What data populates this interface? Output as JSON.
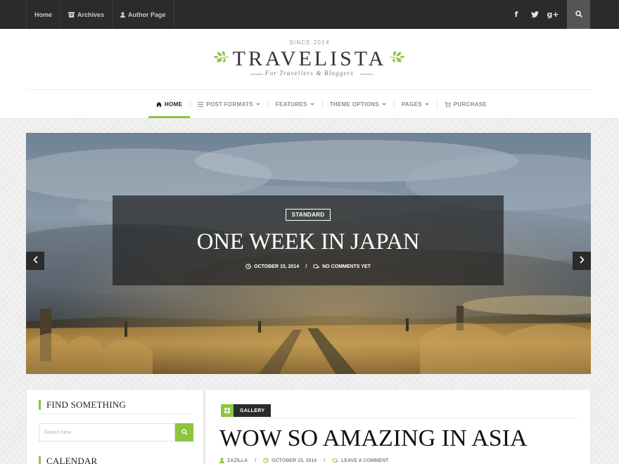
{
  "topbar": {
    "nav": [
      {
        "label": "Home",
        "icon": null
      },
      {
        "label": "Archives",
        "icon": "archive-icon"
      },
      {
        "label": "Author Page",
        "icon": "user-icon"
      }
    ],
    "social": {
      "facebook": "f",
      "twitter": "twitter-bird-icon",
      "googleplus": "g+"
    },
    "search_icon": "search-icon"
  },
  "header": {
    "since": "SINCE 2014",
    "logo": "TRAVELISTA",
    "tagline": "For Travellers & Bloggers",
    "accent": "#8cc63e"
  },
  "mainnav": {
    "items": [
      {
        "label": "HOME",
        "icon": "home-icon",
        "active": true,
        "dropdown": false
      },
      {
        "label": "POST FORMATS",
        "icon": "list-icon",
        "active": false,
        "dropdown": true
      },
      {
        "label": "FEATURES",
        "icon": null,
        "active": false,
        "dropdown": true
      },
      {
        "label": "THEME OPTIONS",
        "icon": null,
        "active": false,
        "dropdown": true
      },
      {
        "label": "PAGES",
        "icon": null,
        "active": false,
        "dropdown": true
      },
      {
        "label": "PURCHASE",
        "icon": "cart-icon",
        "active": false,
        "dropdown": false
      }
    ]
  },
  "slider": {
    "badge": "STANDARD",
    "title": "ONE WEEK IN JAPAN",
    "date": "OCTOBER 15, 2014",
    "comments": "NO COMMENTS YET"
  },
  "sidebar": {
    "search_title": "FIND SOMETHING",
    "search_placeholder": "Search Now",
    "calendar_title": "CALENDAR"
  },
  "post": {
    "category": "GALLERY",
    "category_icon": "grid-icon",
    "title": "WOW SO AMAZING IN ASIA",
    "author": "ZAZILLA",
    "date": "OCTOBER 15, 2014",
    "comments": "LEAVE A COMMENT"
  }
}
